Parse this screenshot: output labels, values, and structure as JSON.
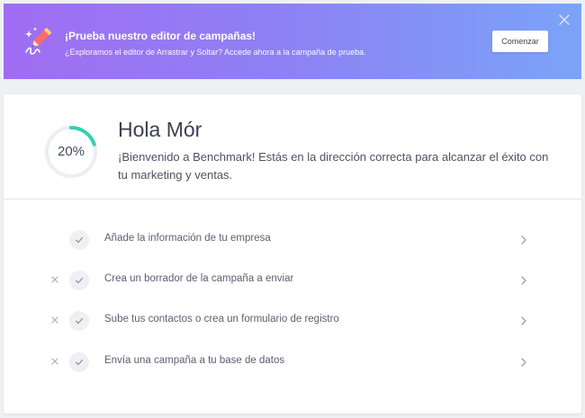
{
  "banner": {
    "title": "¡Prueba nuestro editor de campañas!",
    "text": "¿Exploramos el editor de Arrastrar y Soltar? Accede ahora a la campaña de prueba.",
    "button_label": "Comenzar",
    "icon": "pencil-sparkle-icon",
    "close_icon": "close-icon"
  },
  "progress": {
    "percent_label": "20%",
    "value": 0.2,
    "accent": "#2fd1b3"
  },
  "greeting": "Hola Mór",
  "welcome_text": "¡Bienvenido a Benchmark! Estás en la dirección correcta para alcanzar el éxito con tu marketing y ventas.",
  "tasks": [
    {
      "label": "Añade la información de tu empresa",
      "dismissable": false
    },
    {
      "label": "Crea un borrador de la campaña a enviar",
      "dismissable": true
    },
    {
      "label": "Sube tus contactos o crea un formulario de registro",
      "dismissable": true
    },
    {
      "label": "Envía una campaña a tu base de datos",
      "dismissable": true
    }
  ],
  "colors": {
    "banner_start": "#a06df2",
    "banner_end": "#7aa4f8",
    "progress_accent": "#2fd1b3"
  }
}
